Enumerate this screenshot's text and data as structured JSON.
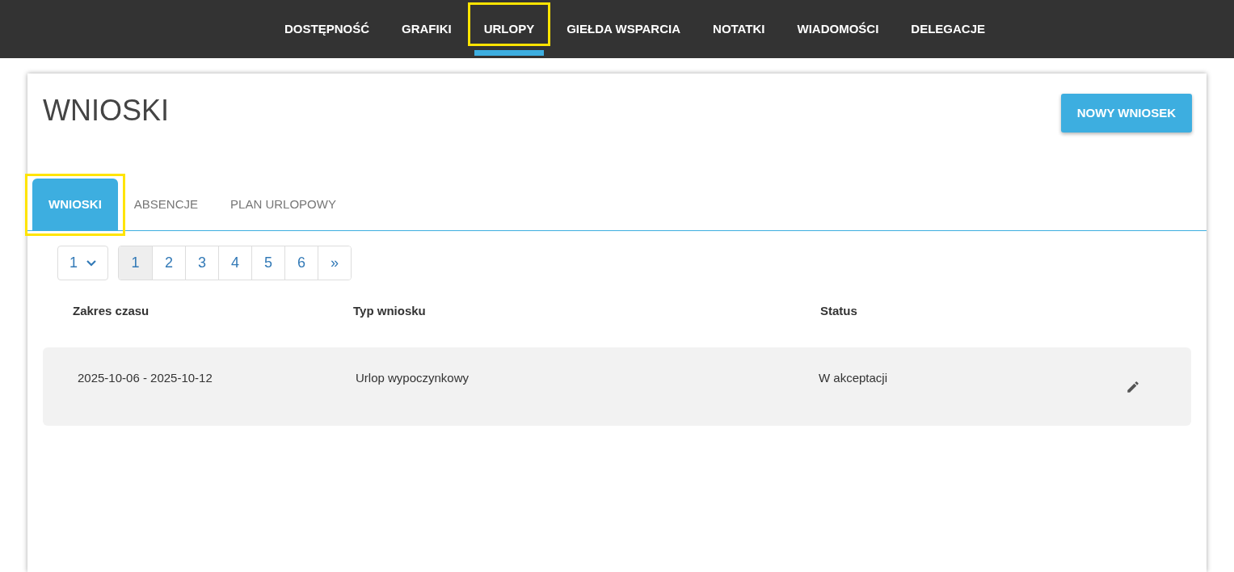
{
  "nav": [
    {
      "label": "DOSTĘPNOŚĆ",
      "selected": false,
      "highlighted": false
    },
    {
      "label": "GRAFIKI",
      "selected": false,
      "highlighted": false
    },
    {
      "label": "URLOPY",
      "selected": true,
      "highlighted": true
    },
    {
      "label": "GIEŁDA WSPARCIA",
      "selected": false,
      "highlighted": false
    },
    {
      "label": "NOTATKI",
      "selected": false,
      "highlighted": false
    },
    {
      "label": "WIADOMOŚCI",
      "selected": false,
      "highlighted": false
    },
    {
      "label": "DELEGACJE",
      "selected": false,
      "highlighted": false
    }
  ],
  "page_title": "WNIOSKI",
  "new_button": "NOWY WNIOSEK",
  "tabs": [
    {
      "label": "WNIOSKI",
      "selected": true,
      "highlighted": true
    },
    {
      "label": "ABSENCJE",
      "selected": false,
      "highlighted": false
    },
    {
      "label": "PLAN URLOPOWY",
      "selected": false,
      "highlighted": false
    }
  ],
  "page_select": {
    "value": "1"
  },
  "pages": [
    {
      "label": "1",
      "selected": true
    },
    {
      "label": "2",
      "selected": false
    },
    {
      "label": "3",
      "selected": false
    },
    {
      "label": "4",
      "selected": false
    },
    {
      "label": "5",
      "selected": false
    },
    {
      "label": "6",
      "selected": false
    },
    {
      "label": "»",
      "selected": false
    }
  ],
  "table": {
    "columns": [
      "Zakres czasu",
      "Typ wniosku",
      "Status"
    ],
    "rows": [
      {
        "cells": [
          "2025-10-06 - 2025-10-12",
          "Urlop wypoczynkowy",
          "W akceptacji"
        ]
      }
    ]
  }
}
